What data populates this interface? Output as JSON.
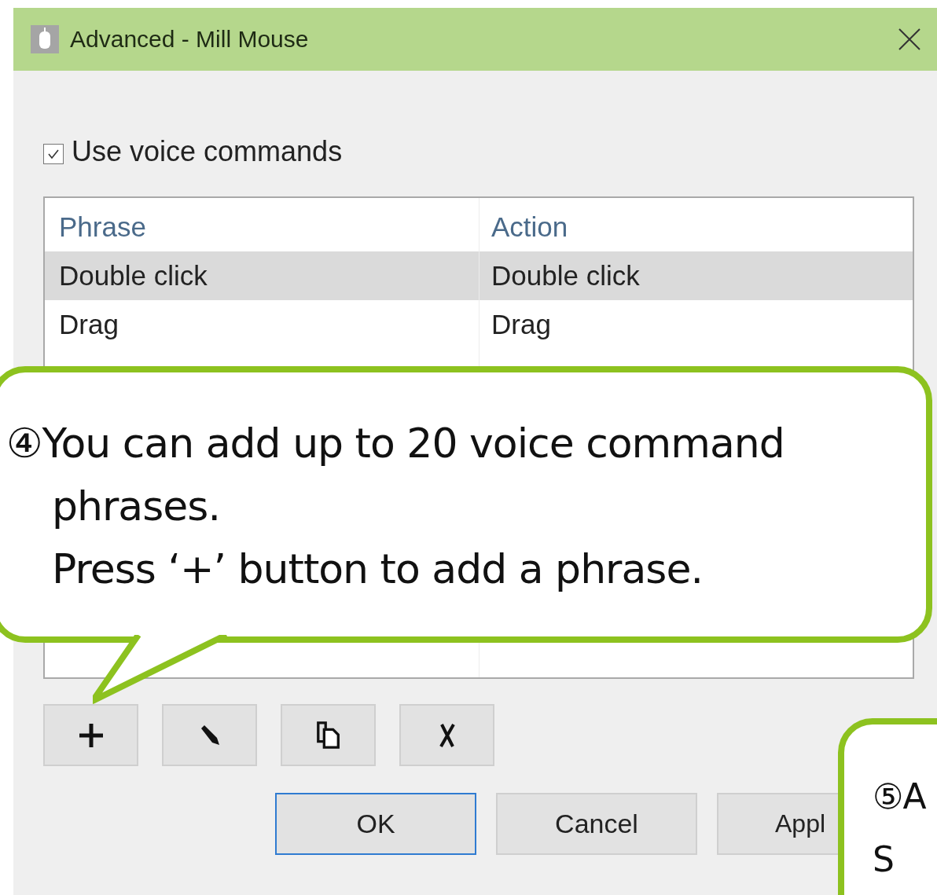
{
  "window": {
    "title": "Advanced - Mill Mouse"
  },
  "voice_commands": {
    "label": "Use voice commands",
    "checked": true
  },
  "table": {
    "columns": [
      "Phrase",
      "Action"
    ],
    "rows": [
      {
        "cells": [
          "Double click",
          "Double click"
        ],
        "selected": true
      },
      {
        "cells": [
          "Drag",
          "Drag"
        ],
        "selected": false
      }
    ]
  },
  "toolbar": [
    {
      "kind": "add"
    },
    {
      "kind": "edit"
    },
    {
      "kind": "copy"
    },
    {
      "kind": "delete"
    }
  ],
  "buttons": [
    {
      "label": "OK",
      "default": true
    },
    {
      "label": "Cancel",
      "default": false
    },
    {
      "label": "Appl",
      "default": false
    }
  ],
  "callouts": [
    {
      "lines": [
        "④You can add up to 20 voice command",
        "phrases.",
        "Press ‘+’ button to add a phrase."
      ]
    },
    {
      "lines": [
        "⑤A",
        "S"
      ]
    }
  ]
}
